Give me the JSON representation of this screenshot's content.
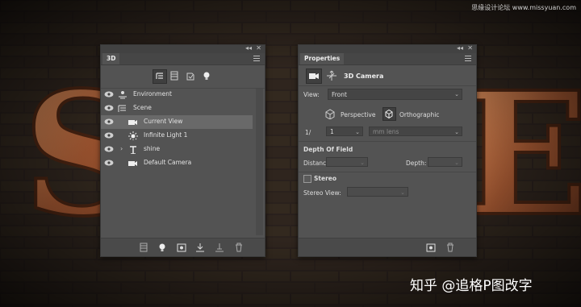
{
  "watermark_top": "思缘设计论坛 www.missyuan.com",
  "watermark_bottom": "知乎 @追格P图改字",
  "background_letters": [
    "S",
    "E"
  ],
  "panel3d": {
    "title": "3D",
    "filter_icons": [
      "scene-filter-icon",
      "mesh-filter-icon",
      "material-filter-icon",
      "light-filter-icon"
    ],
    "items": [
      {
        "label": "Environment",
        "icon": "environment-icon",
        "visible": true
      },
      {
        "label": "Scene",
        "icon": "scene-icon",
        "visible": true
      },
      {
        "label": "Current View",
        "icon": "camera-icon",
        "visible": true,
        "selected": true
      },
      {
        "label": "Infinite Light 1",
        "icon": "light-icon",
        "visible": true
      },
      {
        "label": "shine",
        "icon": "mesh-icon",
        "visible": true,
        "expandable": true
      },
      {
        "label": "Default Camera",
        "icon": "camera-icon",
        "visible": true
      }
    ],
    "bottom_icons": [
      "render-icon",
      "add-light-icon",
      "scene-snapshot-icon",
      "ground-icon",
      "move-icon",
      "trash-icon"
    ]
  },
  "properties": {
    "title": "Properties",
    "header": "3D Camera",
    "view_label": "View:",
    "view_value": "Front",
    "perspective_label": "Perspective",
    "orthographic_label": "Orthographic",
    "lens_prefix": "1/",
    "lens_value": "1",
    "lens_unit": "mm lens",
    "dof_label": "Depth Of Field",
    "distance_label": "Distance:",
    "depth_label": "Depth:",
    "stereo_label": "Stereo",
    "stereo_view_label": "Stereo View:"
  },
  "colors": {
    "panel_bg": "#535353",
    "selected_row": "#696969",
    "copper": "#b86a3e"
  }
}
